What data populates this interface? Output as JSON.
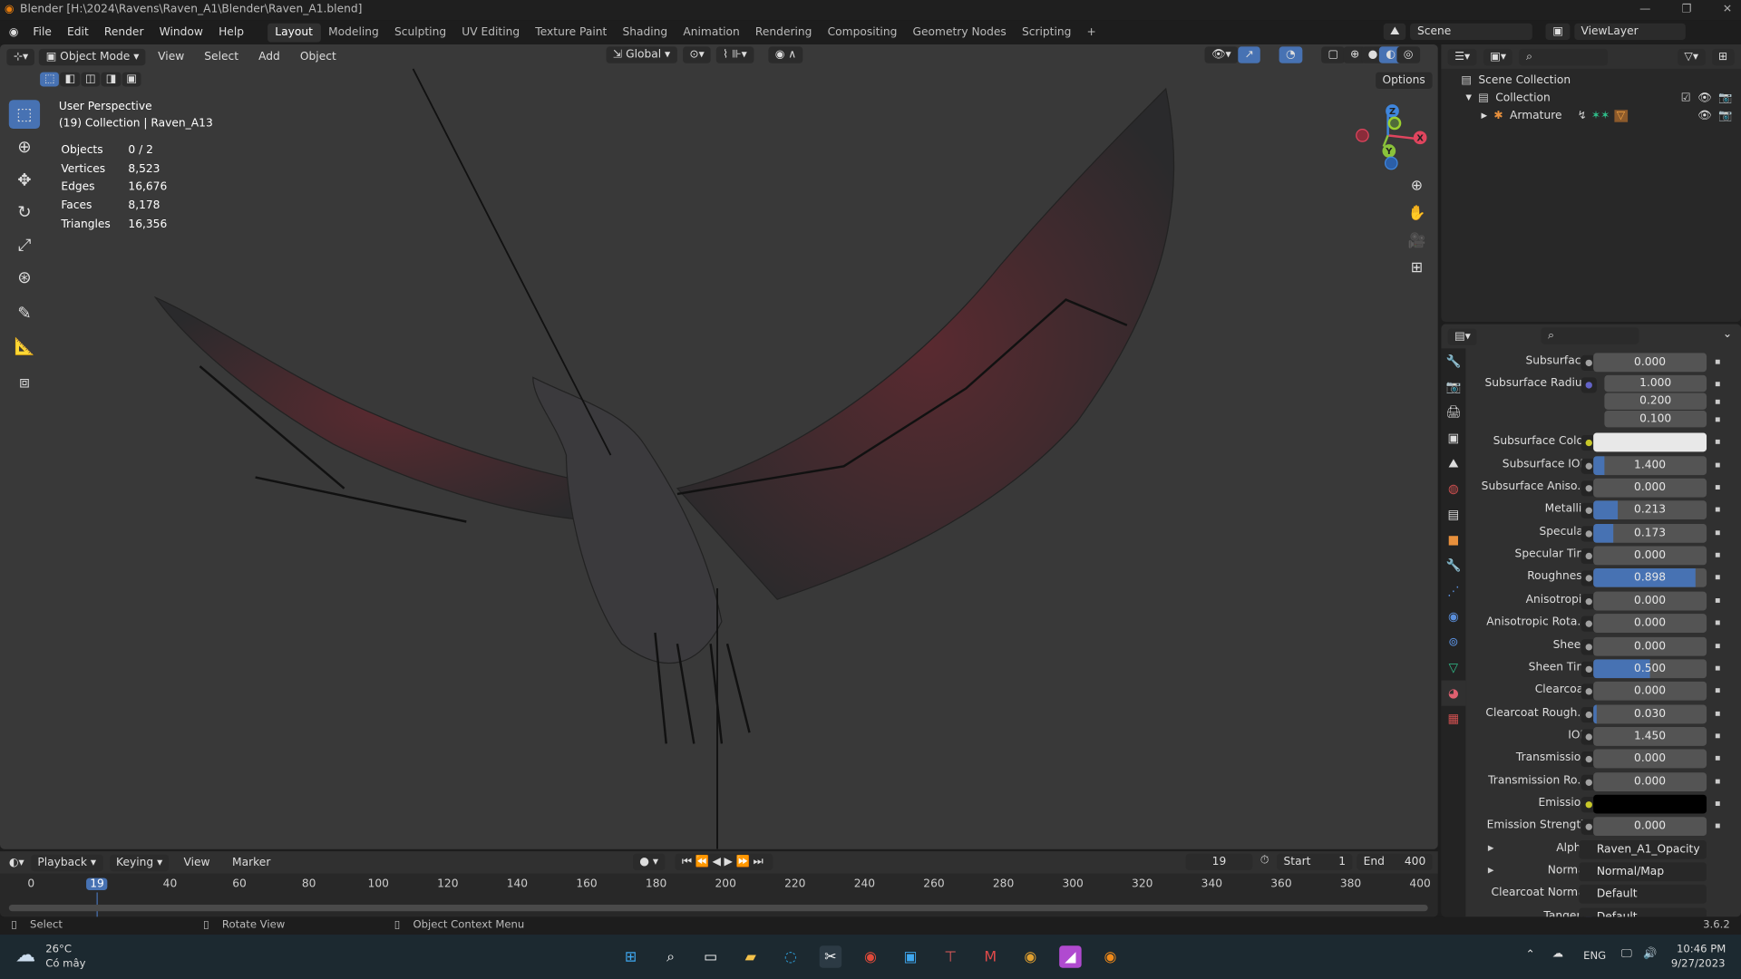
{
  "window": {
    "title": "Blender [H:\\2024\\Ravens\\Raven_A1\\Blender\\Raven_A1.blend]",
    "minimize": "—",
    "maximize": "❐",
    "close": "✕"
  },
  "menu": [
    "File",
    "Edit",
    "Render",
    "Window",
    "Help"
  ],
  "workspaces": [
    "Layout",
    "Modeling",
    "Sculpting",
    "UV Editing",
    "Texture Paint",
    "Shading",
    "Animation",
    "Rendering",
    "Compositing",
    "Geometry Nodes",
    "Scripting",
    "+"
  ],
  "scene": {
    "label": "Scene",
    "view_layer": "ViewLayer"
  },
  "viewport": {
    "mode": "Object Mode",
    "menus": [
      "View",
      "Select",
      "Add",
      "Object"
    ],
    "orientation": "Global",
    "options": "Options",
    "perspective": "User Perspective",
    "collection": "(19) Collection | Raven_A13",
    "stats": [
      [
        "Objects",
        "0 / 2"
      ],
      [
        "Vertices",
        "8,523"
      ],
      [
        "Edges",
        "16,676"
      ],
      [
        "Faces",
        "8,178"
      ],
      [
        "Triangles",
        "16,356"
      ]
    ],
    "gizmo": {
      "x": "X",
      "y": "Y",
      "z": "Z"
    }
  },
  "outliner": {
    "items": [
      {
        "label": "Scene Collection"
      },
      {
        "label": "Collection"
      },
      {
        "label": "Armature"
      }
    ]
  },
  "properties": {
    "rows": [
      {
        "label": "Subsurface",
        "value": "0.000",
        "fill": 0,
        "socket": "#a1a1a1"
      },
      {
        "label": "Subsurface Radius",
        "value": "1.000",
        "fill": 0,
        "socket": "#6363c7",
        "sub": true
      },
      {
        "label": "",
        "value": "0.200",
        "fill": 0,
        "sub": true,
        "cont": true
      },
      {
        "label": "",
        "value": "0.100",
        "fill": 0,
        "sub": true,
        "cont": true
      },
      {
        "label": "Subsurface Color",
        "value": "",
        "color": "#e8e8e8",
        "socket": "#c7c729"
      },
      {
        "label": "Subsurface IOR",
        "value": "1.400",
        "fill": 0.1,
        "socket": "#a1a1a1"
      },
      {
        "label": "Subsurface Aniso...",
        "value": "0.000",
        "fill": 0,
        "socket": "#a1a1a1"
      },
      {
        "label": "Metallic",
        "value": "0.213",
        "fill": 0.213,
        "socket": "#a1a1a1"
      },
      {
        "label": "Specular",
        "value": "0.173",
        "fill": 0.173,
        "socket": "#a1a1a1"
      },
      {
        "label": "Specular Tint",
        "value": "0.000",
        "fill": 0,
        "socket": "#a1a1a1"
      },
      {
        "label": "Roughness",
        "value": "0.898",
        "fill": 0.898,
        "socket": "#a1a1a1"
      },
      {
        "label": "Anisotropic",
        "value": "0.000",
        "fill": 0,
        "socket": "#a1a1a1"
      },
      {
        "label": "Anisotropic Rota...",
        "value": "0.000",
        "fill": 0,
        "socket": "#a1a1a1"
      },
      {
        "label": "Sheen",
        "value": "0.000",
        "fill": 0,
        "socket": "#a1a1a1"
      },
      {
        "label": "Sheen Tint",
        "value": "0.500",
        "fill": 0.5,
        "socket": "#a1a1a1"
      },
      {
        "label": "Clearcoat",
        "value": "0.000",
        "fill": 0,
        "socket": "#a1a1a1"
      },
      {
        "label": "Clearcoat Rough...",
        "value": "0.030",
        "fill": 0.03,
        "socket": "#a1a1a1"
      },
      {
        "label": "IOR",
        "value": "1.450",
        "fill": 0,
        "socket": "#a1a1a1"
      },
      {
        "label": "Transmission",
        "value": "0.000",
        "fill": 0,
        "socket": "#a1a1a1"
      },
      {
        "label": "Transmission Ro...",
        "value": "0.000",
        "fill": 0,
        "socket": "#a1a1a1"
      },
      {
        "label": "Emission",
        "value": "",
        "color": "#000000",
        "socket": "#c7c729"
      },
      {
        "label": "Emission Strength",
        "value": "0.000",
        "fill": 0,
        "socket": "#a1a1a1"
      },
      {
        "label": "Alpha",
        "value": "Raven_A1_Opacity",
        "link": true,
        "expand": true,
        "socket": "#a1a1a1"
      },
      {
        "label": "Normal",
        "value": "Normal/Map",
        "link": true,
        "expand": true,
        "socket": "#6363c7"
      },
      {
        "label": "Clearcoat Normal",
        "value": "Default",
        "link": true,
        "socket": "#6363c7"
      },
      {
        "label": "Tangent",
        "value": "Default",
        "link": true,
        "socket": "#6363c7"
      }
    ]
  },
  "timeline": {
    "menus": [
      "Playback",
      "Keying",
      "View",
      "Marker"
    ],
    "current_frame": "19",
    "start_label": "Start",
    "start": "1",
    "end_label": "End",
    "end": "400",
    "ticks": [
      "0",
      "19",
      "40",
      "60",
      "80",
      "100",
      "120",
      "140",
      "160",
      "180",
      "200",
      "220",
      "240",
      "260",
      "280",
      "300",
      "320",
      "340",
      "360",
      "380",
      "400"
    ],
    "frame_max": 400
  },
  "status": {
    "select": "Select",
    "rotate": "Rotate View",
    "context": "Object Context Menu",
    "version": "3.6.2"
  },
  "taskbar": {
    "temp": "26°C",
    "weather": "Có mây",
    "lang": "ENG",
    "time": "10:46 PM",
    "date": "9/27/2023"
  },
  "colors": {
    "accent": "#4772b3",
    "x_axis": "#e0455e",
    "y_axis": "#8ac23a",
    "z_axis": "#3f86dd"
  }
}
